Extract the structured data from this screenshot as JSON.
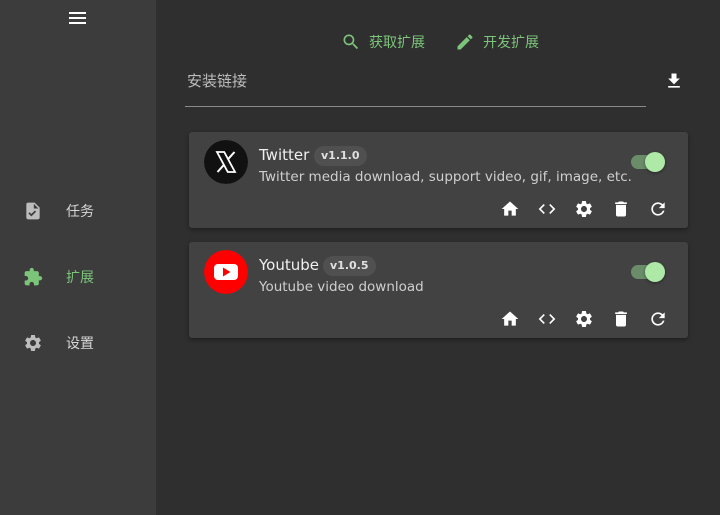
{
  "sidebar": {
    "menu_icon": "hamburger-icon",
    "items": [
      {
        "label": "任务",
        "icon": "task-icon"
      },
      {
        "label": "扩展",
        "icon": "puzzle-icon",
        "active": true
      },
      {
        "label": "设置",
        "icon": "gear-icon"
      }
    ]
  },
  "top_actions": {
    "get_extensions": "获取扩展",
    "develop_extensions": "开发扩展"
  },
  "install": {
    "placeholder": "安装链接",
    "download_icon": "download-icon"
  },
  "extensions": [
    {
      "name": "Twitter",
      "version": "v1.1.0",
      "description": "Twitter media download, support video, gif, image, etc.",
      "enabled": true,
      "icon": "x-logo"
    },
    {
      "name": "Youtube",
      "version": "v1.0.5",
      "description": "Youtube video download",
      "enabled": true,
      "icon": "youtube-logo"
    }
  ],
  "colors": {
    "accent": "#7cc47a",
    "sidebar_bg": "#3c3c3c",
    "main_bg": "#2f2f2f",
    "card_bg": "#424242",
    "youtube_red": "#ff0000"
  }
}
